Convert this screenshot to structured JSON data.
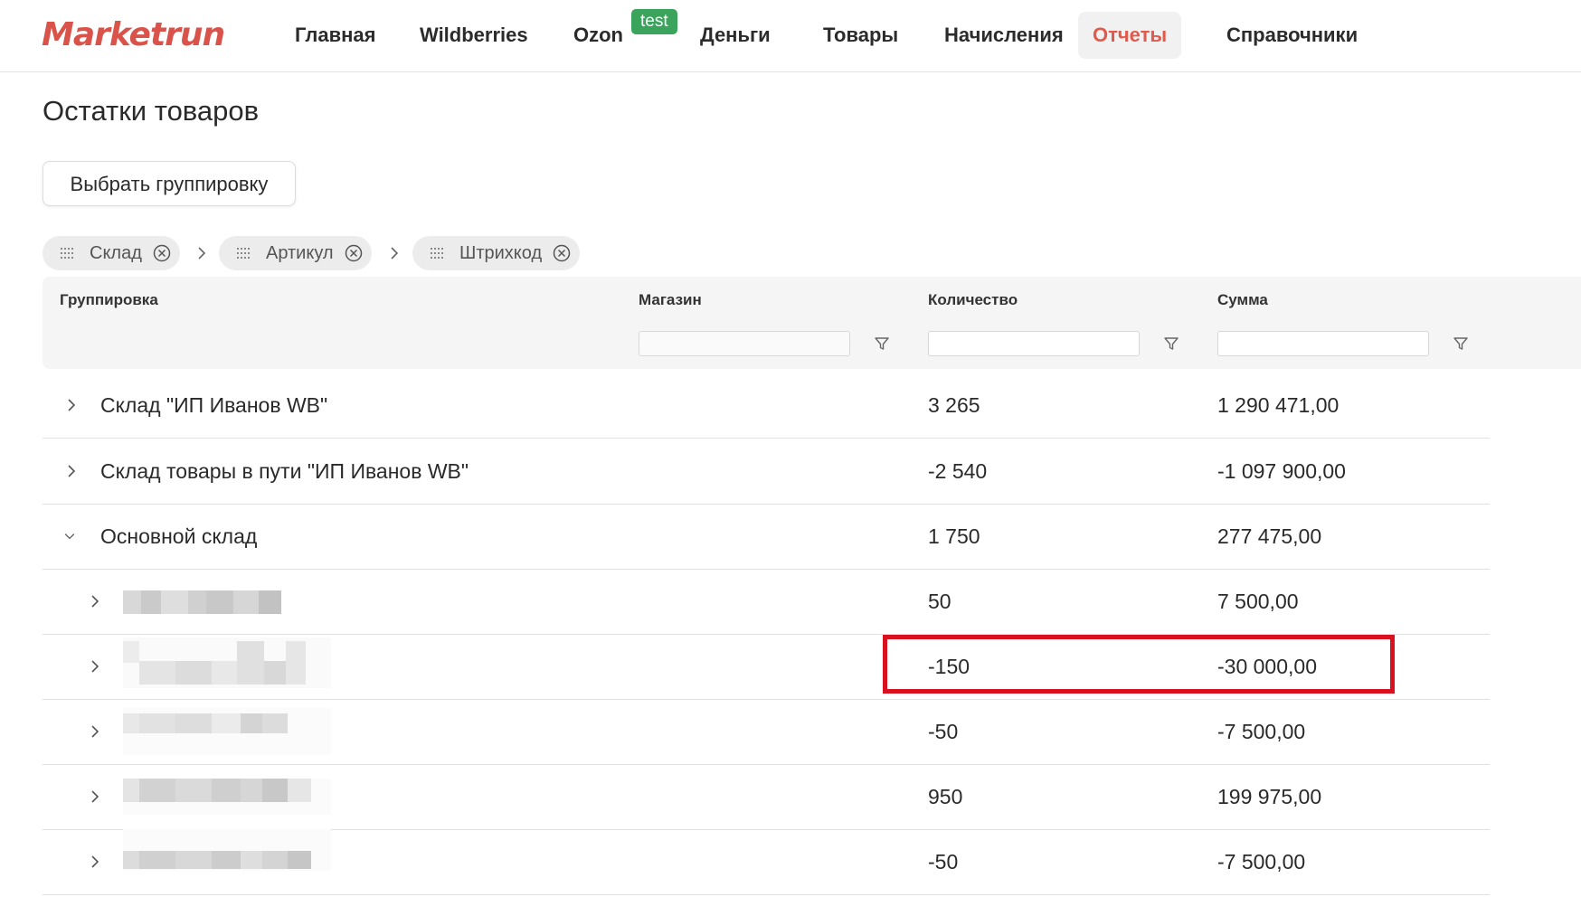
{
  "app": {
    "logo_m": "M",
    "logo_rest": "arketrun"
  },
  "nav": {
    "items": [
      {
        "label": "Главная"
      },
      {
        "label": "Wildberries"
      },
      {
        "label": "Ozon"
      },
      {
        "label": "Деньги"
      },
      {
        "label": "Товары"
      },
      {
        "label": "Начисления"
      },
      {
        "label": "Отчеты",
        "active": true
      },
      {
        "label": "Справочники"
      }
    ],
    "ozon_badge": "test"
  },
  "page": {
    "title": "Остатки товаров",
    "group_button": "Выбрать группировку"
  },
  "grouping_chips": [
    {
      "label": "Склад"
    },
    {
      "label": "Артикул"
    },
    {
      "label": "Штрихкод"
    }
  ],
  "table": {
    "columns": {
      "group": "Группировка",
      "store": "Магазин",
      "qty": "Количество",
      "sum": "Сумма"
    },
    "filters": {
      "store": "",
      "qty": "",
      "sum": ""
    },
    "rows": [
      {
        "name": "Склад \"ИП Иванов WB\"",
        "qty": "3 265",
        "sum": "1 290 471,00",
        "expanded": false
      },
      {
        "name": "Склад товары в пути \"ИП Иванов WB\"",
        "qty": "-2 540",
        "sum": "-1 097 900,00",
        "expanded": false
      },
      {
        "name": "Основной склад",
        "qty": "1 750",
        "sum": "277 475,00",
        "expanded": true
      },
      {
        "name": "",
        "qty": "50",
        "sum": "7 500,00",
        "expanded": false
      },
      {
        "name": "",
        "qty": "-150",
        "sum": "-30 000,00",
        "expanded": false,
        "highlighted": true
      },
      {
        "name": "",
        "qty": "-50",
        "sum": "-7 500,00",
        "expanded": false
      },
      {
        "name": "",
        "qty": "950",
        "sum": "199 975,00",
        "expanded": false
      },
      {
        "name": "",
        "qty": "-50",
        "sum": "-7 500,00",
        "expanded": false
      }
    ]
  },
  "colors": {
    "brand": "#d9534a",
    "active_nav": "#e05a4e",
    "badge": "#3aa35c",
    "highlight_border": "#d9101e"
  }
}
